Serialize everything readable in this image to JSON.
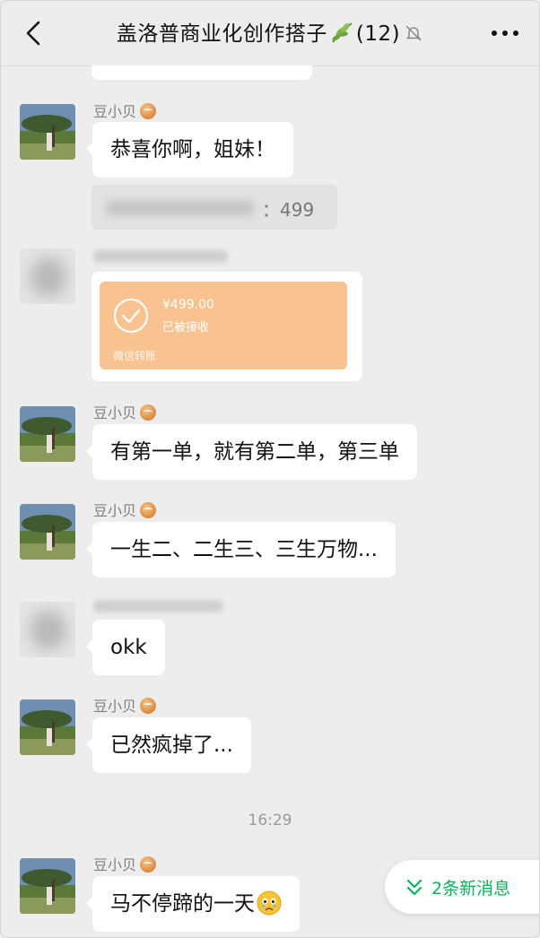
{
  "header": {
    "title": "盖洛普商业化创作搭子",
    "count": "(12)"
  },
  "messages": [
    {
      "name": "豆小贝",
      "text": "恭喜你啊，姐妹！",
      "quote": "：499"
    },
    {
      "transfer_amount": "¥499.00",
      "transfer_status": "已被接收",
      "transfer_label": "微信转账"
    },
    {
      "name": "豆小贝",
      "text": "有第一单，就有第二单，第三单"
    },
    {
      "name": "豆小贝",
      "text": "一生二、二生三、三生万物..."
    },
    {
      "text": "okk"
    },
    {
      "name": "豆小贝",
      "text": "已然疯掉了..."
    },
    {
      "name": "豆小贝",
      "text": "马不停蹄的一天"
    }
  ],
  "timestamp": "16:29",
  "new_messages_label": "2条新消息",
  "icons": [
    "back-chevron-icon",
    "leaf-icon",
    "bell-mute-icon",
    "more-dots-icon",
    "check-circle-icon",
    "crying-emoji-icon",
    "double-chevron-down-icon"
  ],
  "colors": {
    "background": "#ededed",
    "bubble": "#ffffff",
    "transfer": "#f9c391",
    "accent_green": "#07b35a"
  }
}
